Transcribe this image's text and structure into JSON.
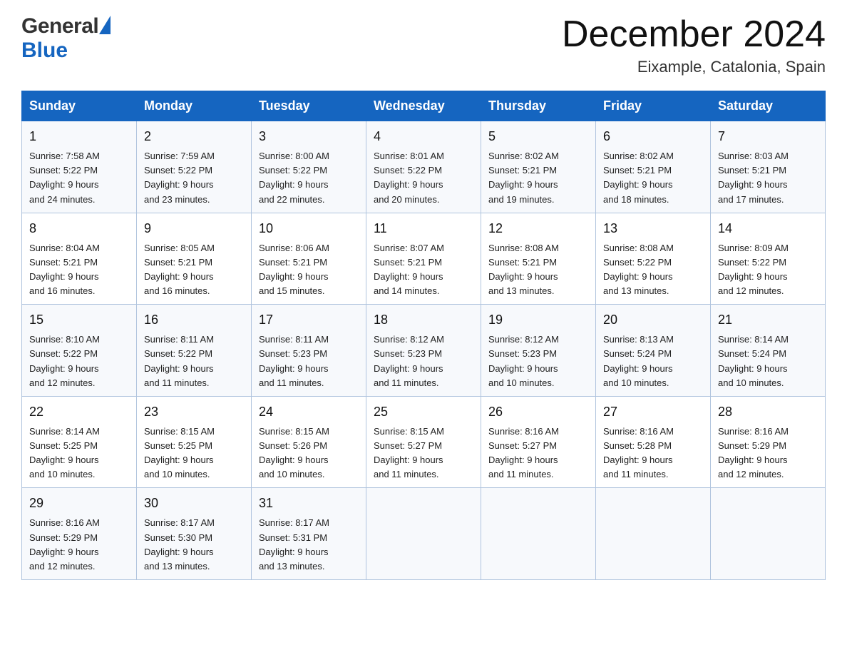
{
  "header": {
    "logo_general": "General",
    "logo_blue": "Blue",
    "month_title": "December 2024",
    "location": "Eixample, Catalonia, Spain"
  },
  "days_of_week": [
    "Sunday",
    "Monday",
    "Tuesday",
    "Wednesday",
    "Thursday",
    "Friday",
    "Saturday"
  ],
  "weeks": [
    [
      {
        "num": "1",
        "sunrise": "7:58 AM",
        "sunset": "5:22 PM",
        "daylight": "9 hours and 24 minutes."
      },
      {
        "num": "2",
        "sunrise": "7:59 AM",
        "sunset": "5:22 PM",
        "daylight": "9 hours and 23 minutes."
      },
      {
        "num": "3",
        "sunrise": "8:00 AM",
        "sunset": "5:22 PM",
        "daylight": "9 hours and 22 minutes."
      },
      {
        "num": "4",
        "sunrise": "8:01 AM",
        "sunset": "5:22 PM",
        "daylight": "9 hours and 20 minutes."
      },
      {
        "num": "5",
        "sunrise": "8:02 AM",
        "sunset": "5:21 PM",
        "daylight": "9 hours and 19 minutes."
      },
      {
        "num": "6",
        "sunrise": "8:02 AM",
        "sunset": "5:21 PM",
        "daylight": "9 hours and 18 minutes."
      },
      {
        "num": "7",
        "sunrise": "8:03 AM",
        "sunset": "5:21 PM",
        "daylight": "9 hours and 17 minutes."
      }
    ],
    [
      {
        "num": "8",
        "sunrise": "8:04 AM",
        "sunset": "5:21 PM",
        "daylight": "9 hours and 16 minutes."
      },
      {
        "num": "9",
        "sunrise": "8:05 AM",
        "sunset": "5:21 PM",
        "daylight": "9 hours and 16 minutes."
      },
      {
        "num": "10",
        "sunrise": "8:06 AM",
        "sunset": "5:21 PM",
        "daylight": "9 hours and 15 minutes."
      },
      {
        "num": "11",
        "sunrise": "8:07 AM",
        "sunset": "5:21 PM",
        "daylight": "9 hours and 14 minutes."
      },
      {
        "num": "12",
        "sunrise": "8:08 AM",
        "sunset": "5:21 PM",
        "daylight": "9 hours and 13 minutes."
      },
      {
        "num": "13",
        "sunrise": "8:08 AM",
        "sunset": "5:22 PM",
        "daylight": "9 hours and 13 minutes."
      },
      {
        "num": "14",
        "sunrise": "8:09 AM",
        "sunset": "5:22 PM",
        "daylight": "9 hours and 12 minutes."
      }
    ],
    [
      {
        "num": "15",
        "sunrise": "8:10 AM",
        "sunset": "5:22 PM",
        "daylight": "9 hours and 12 minutes."
      },
      {
        "num": "16",
        "sunrise": "8:11 AM",
        "sunset": "5:22 PM",
        "daylight": "9 hours and 11 minutes."
      },
      {
        "num": "17",
        "sunrise": "8:11 AM",
        "sunset": "5:23 PM",
        "daylight": "9 hours and 11 minutes."
      },
      {
        "num": "18",
        "sunrise": "8:12 AM",
        "sunset": "5:23 PM",
        "daylight": "9 hours and 11 minutes."
      },
      {
        "num": "19",
        "sunrise": "8:12 AM",
        "sunset": "5:23 PM",
        "daylight": "9 hours and 10 minutes."
      },
      {
        "num": "20",
        "sunrise": "8:13 AM",
        "sunset": "5:24 PM",
        "daylight": "9 hours and 10 minutes."
      },
      {
        "num": "21",
        "sunrise": "8:14 AM",
        "sunset": "5:24 PM",
        "daylight": "9 hours and 10 minutes."
      }
    ],
    [
      {
        "num": "22",
        "sunrise": "8:14 AM",
        "sunset": "5:25 PM",
        "daylight": "9 hours and 10 minutes."
      },
      {
        "num": "23",
        "sunrise": "8:15 AM",
        "sunset": "5:25 PM",
        "daylight": "9 hours and 10 minutes."
      },
      {
        "num": "24",
        "sunrise": "8:15 AM",
        "sunset": "5:26 PM",
        "daylight": "9 hours and 10 minutes."
      },
      {
        "num": "25",
        "sunrise": "8:15 AM",
        "sunset": "5:27 PM",
        "daylight": "9 hours and 11 minutes."
      },
      {
        "num": "26",
        "sunrise": "8:16 AM",
        "sunset": "5:27 PM",
        "daylight": "9 hours and 11 minutes."
      },
      {
        "num": "27",
        "sunrise": "8:16 AM",
        "sunset": "5:28 PM",
        "daylight": "9 hours and 11 minutes."
      },
      {
        "num": "28",
        "sunrise": "8:16 AM",
        "sunset": "5:29 PM",
        "daylight": "9 hours and 12 minutes."
      }
    ],
    [
      {
        "num": "29",
        "sunrise": "8:16 AM",
        "sunset": "5:29 PM",
        "daylight": "9 hours and 12 minutes."
      },
      {
        "num": "30",
        "sunrise": "8:17 AM",
        "sunset": "5:30 PM",
        "daylight": "9 hours and 13 minutes."
      },
      {
        "num": "31",
        "sunrise": "8:17 AM",
        "sunset": "5:31 PM",
        "daylight": "9 hours and 13 minutes."
      },
      null,
      null,
      null,
      null
    ]
  ],
  "labels": {
    "sunrise": "Sunrise:",
    "sunset": "Sunset:",
    "daylight": "Daylight:"
  }
}
